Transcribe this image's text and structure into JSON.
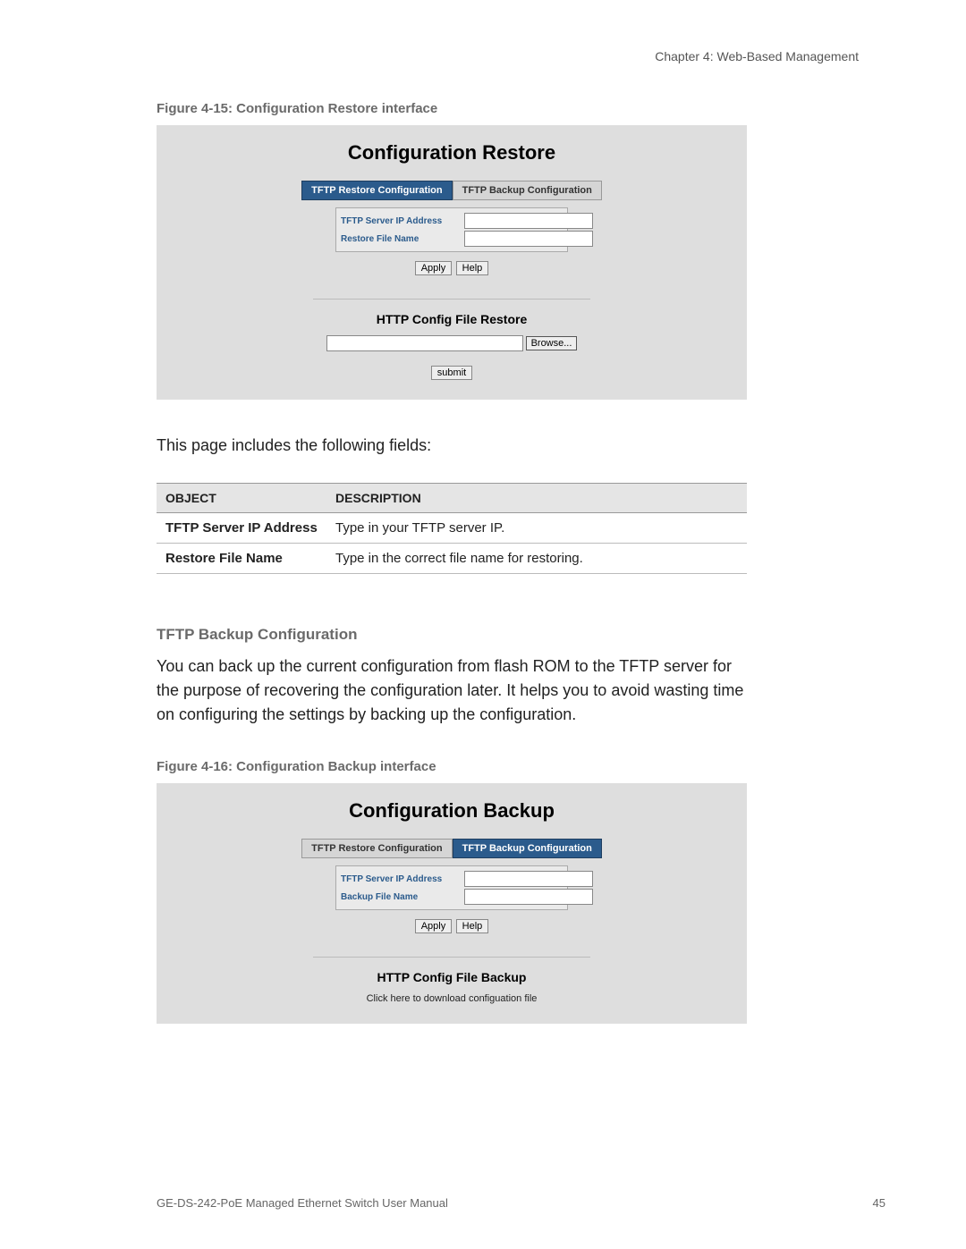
{
  "chapter": "Chapter 4: Web-Based Management",
  "figure1": {
    "caption": "Figure 4-15: Configuration Restore interface",
    "title": "Configuration Restore",
    "tab_restore": "TFTP Restore Configuration",
    "tab_backup": "TFTP Backup Configuration",
    "field1_label": "TFTP Server IP Address",
    "field1_value": "",
    "field2_label": "Restore File Name",
    "field2_value": "",
    "apply": "Apply",
    "help": "Help",
    "http_title": "HTTP Config File Restore",
    "file_value": "",
    "browse": "Browse...",
    "submit": "submit"
  },
  "intro_text": "This page includes the following fields:",
  "table": {
    "header_object": "Object",
    "header_desc": "Description",
    "rows": [
      {
        "object": "TFTP Server IP Address",
        "desc": "Type in your TFTP server IP."
      },
      {
        "object": "Restore File Name",
        "desc": "Type in the correct file name for restoring."
      }
    ]
  },
  "section": {
    "heading": "TFTP Backup Configuration",
    "body": "You can back up the current configuration from flash ROM to the TFTP server for the purpose of recovering the configuration later. It helps you to avoid wasting time on configuring the settings by backing up the configuration."
  },
  "figure2": {
    "caption": "Figure 4-16: Configuration Backup interface",
    "title": "Configuration Backup",
    "tab_restore": "TFTP Restore Configuration",
    "tab_backup": "TFTP Backup Configuration",
    "field1_label": "TFTP Server IP Address",
    "field1_value": "",
    "field2_label": "Backup File Name",
    "field2_value": "",
    "apply": "Apply",
    "help": "Help",
    "http_title": "HTTP Config File Backup",
    "download_text": "Click here to download configuation file"
  },
  "footer": {
    "left": "GE-DS-242-PoE Managed Ethernet Switch User Manual",
    "right": "45"
  }
}
